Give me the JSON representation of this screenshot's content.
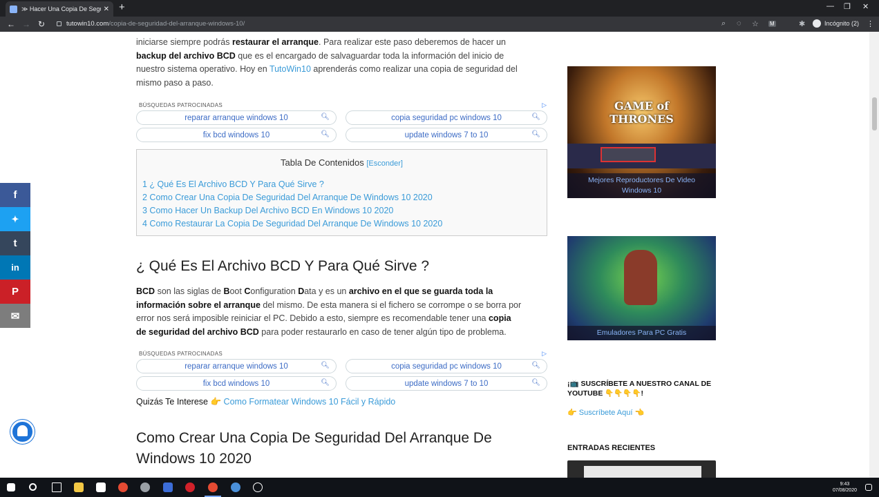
{
  "browser": {
    "tab_title": "≫ Hacer Una Copia De Seguridad Del Arranque",
    "tab_close": "✕",
    "new_tab": "+",
    "back": "←",
    "forward": "→",
    "reload": "C",
    "url_host": "tutowin10.com",
    "url_path": "/copia-de-seguridad-del-arranque-windows-10/",
    "incognito_label": "Incógnito (2)",
    "menu": "⋮",
    "icons": [
      "search-icon",
      "eye-off-icon",
      "star-icon",
      "extension-m-icon",
      "puzzle-icon",
      "incognito-icon",
      "menu-icon"
    ]
  },
  "article": {
    "intro": {
      "line1_pre": "iniciarse siempre podrás ",
      "line1_bold": "restaurar el arranque",
      "line1_post": ". Para realizar este paso deberemos de hacer un",
      "line2_bold": "backup del archivo BCD",
      "line2_post": " que es el encargado de salvaguardar toda la información del inicio de",
      "line3_pre": "nuestro sistema operativo. Hoy en ",
      "line3_link": "TutoWin10",
      "line3_post": " aprenderás como realizar una copia de seguridad del",
      "line4": "mismo paso a paso."
    },
    "sponsored_1": {
      "label": "BÚSQUEDAS PATROCINADAS",
      "pills": [
        "reparar arranque windows 10",
        "copia seguridad pc windows 10",
        "fix bcd windows 10",
        "update windows 7 to 10"
      ]
    },
    "toc": {
      "title": "Tabla De Contenidos",
      "hide": "[Esconder]",
      "items": [
        "1 ¿ Qué Es El Archivo BCD Y Para Qué Sirve ?",
        "2 Como Crear Una Copia De Seguridad Del Arranque De Windows 10 2020",
        "3 Como Hacer Un Backup Del Archivo BCD En Windows 10 2020",
        "4 Como Restaurar La Copia De Seguridad Del Arranque De Windows 10 2020"
      ]
    },
    "h2_what": "¿ Qué Es El Archivo BCD Y Para Qué Sirve ?",
    "bcd_para": {
      "l1_a": "BCD",
      "l1_b": " son las siglas de ",
      "l1_c": "B",
      "l1_d": "oot ",
      "l1_e": "C",
      "l1_f": "onfiguration ",
      "l1_g": "D",
      "l1_h": "ata y es un ",
      "l1_i": "archivo en el que se guarda toda la",
      "l2_a": "información sobre el arranque",
      "l2_b": " del mismo. De esta manera si el fichero se corrompe o se borra por",
      "l3": "error nos será imposible reiniciar el PC. Debido a esto, siempre es recomendable tener una ",
      "l3_bold": "copia",
      "l4_bold": "de seguridad del archivo BCD",
      "l4_post": " para poder restaurarlo en caso de tener algún tipo de problema."
    },
    "sponsored_2": {
      "label": "BÚSQUEDAS PATROCINADAS",
      "pills": [
        "reparar arranque windows 10",
        "copia seguridad pc windows 10",
        "fix bcd windows 10",
        "update windows 7 to 10"
      ]
    },
    "interest_label": "Quizás Te Interese",
    "interest_link": "Como Formatear Windows 10 Fácil y Rápido",
    "h2_create_1": "Como Crear Una Copia De Seguridad Del Arranque De",
    "h2_create_2": "Windows 10 2020"
  },
  "sidebar": {
    "ad1_logo": "GAME of THRONES",
    "ad1_caption": "Mejores Reproductores De Video Windows 10",
    "ad2_caption": "Emuladores Para PC Gratis",
    "subscribe_heading_1": "¡📺 SUSCRÍBETE A NUESTRO CANAL DE",
    "subscribe_heading_2": "YOUTUBE 👇👇👇👇!",
    "subscribe_link": "Suscríbete Aquí",
    "recent_heading": "ENTRADAS RECIENTES"
  },
  "share": [
    {
      "icon": "facebook-icon",
      "glyph": "f",
      "color": "#3b5998"
    },
    {
      "icon": "twitter-icon",
      "glyph": "🐦",
      "color": "#1da1f2"
    },
    {
      "icon": "tumblr-icon",
      "glyph": "t",
      "color": "#35465c"
    },
    {
      "icon": "linkedin-icon",
      "glyph": "in",
      "color": "#0077b5"
    },
    {
      "icon": "pinterest-icon",
      "glyph": "P",
      "color": "#cb2027"
    },
    {
      "icon": "email-icon",
      "glyph": "✉",
      "color": "#7d7d7d"
    }
  ],
  "taskbar": {
    "time": "9:43",
    "date": "07/08/2020"
  }
}
